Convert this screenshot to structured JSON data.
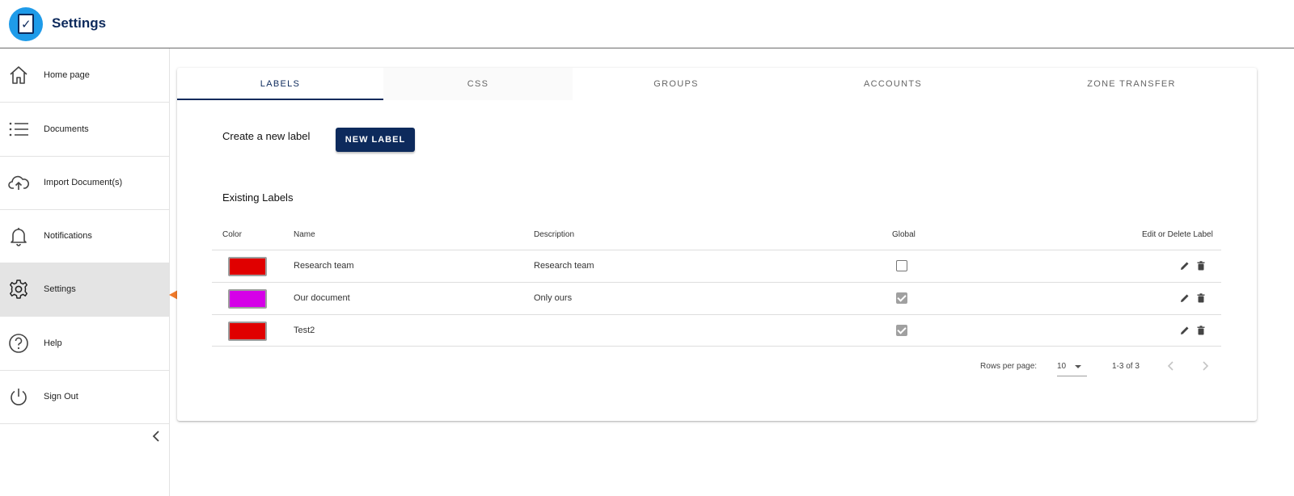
{
  "app": {
    "title": "Settings"
  },
  "sidebar": {
    "items": [
      {
        "label": "Home page",
        "icon": "home-icon"
      },
      {
        "label": "Documents",
        "icon": "list-icon"
      },
      {
        "label": "Import Document(s)",
        "icon": "cloud-upload-icon"
      },
      {
        "label": "Notifications",
        "icon": "bell-icon"
      },
      {
        "label": "Settings",
        "icon": "gear-icon",
        "active": true
      },
      {
        "label": "Help",
        "icon": "help-circle-icon"
      },
      {
        "label": "Sign Out",
        "icon": "power-icon"
      }
    ]
  },
  "tabs": [
    {
      "label": "LABELS",
      "active": true
    },
    {
      "label": "CSS"
    },
    {
      "label": "GROUPS"
    },
    {
      "label": "ACCOUNTS"
    },
    {
      "label": "ZONE TRANSFER"
    }
  ],
  "create": {
    "text": "Create a new label",
    "button_label": "NEW LABEL"
  },
  "existing": {
    "title": "Existing Labels"
  },
  "table": {
    "headers": {
      "color": "Color",
      "name": "Name",
      "description": "Description",
      "global": "Global",
      "actions": "Edit or Delete Label"
    },
    "rows": [
      {
        "color": "#e00000",
        "name": "Research team",
        "description": "Research team",
        "global": false
      },
      {
        "color": "#d500e8",
        "name": "Our document",
        "description": "Only ours",
        "global": true
      },
      {
        "color": "#e00000",
        "name": "Test2",
        "description": "",
        "global": true
      }
    ]
  },
  "pagination": {
    "rows_per_page_label": "Rows per page:",
    "rows_per_page": "10",
    "range": "1-3 of 3"
  },
  "colors": {
    "primary": "#0d2a5c",
    "logo": "#1e9be9",
    "arrow": "#f07a2a"
  }
}
